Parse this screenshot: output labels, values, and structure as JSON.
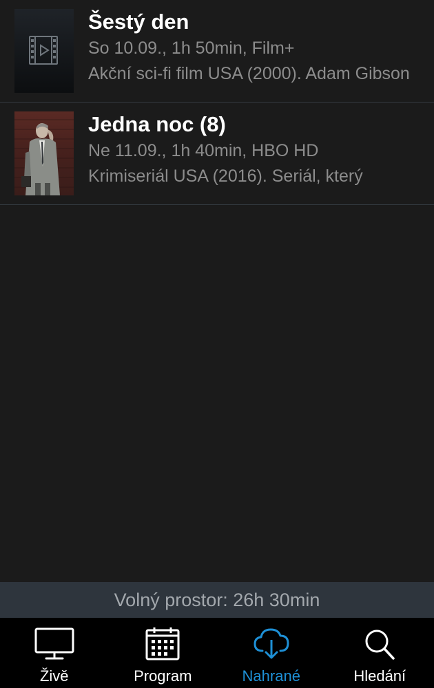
{
  "recordings": [
    {
      "title": "Šestý den",
      "meta": "So 10.09., 1h 50min, Film+",
      "description": "Akční sci-fi film USA (2000). Adam Gibson",
      "thumbnail": "film-placeholder-icon"
    },
    {
      "title": "Jedna noc (8)",
      "meta": "Ne 11.09., 1h 40min, HBO HD",
      "description": "Krimiseriál USA (2016). Seriál, který",
      "thumbnail": "photo-man-on-phone"
    }
  ],
  "storage": {
    "free_space": "Volný prostor: 26h 30min"
  },
  "tabs": [
    {
      "label": "Živě",
      "icon": "tv-monitor-icon",
      "active": false
    },
    {
      "label": "Program",
      "icon": "calendar-icon",
      "active": false
    },
    {
      "label": "Nahrané",
      "icon": "cloud-download-icon",
      "active": true
    },
    {
      "label": "Hledání",
      "icon": "search-icon",
      "active": false
    }
  ],
  "colors": {
    "background": "#1b1b1b",
    "accent": "#1e90d6",
    "tabbar": "#000000",
    "storage_bar": "#2e353d"
  }
}
